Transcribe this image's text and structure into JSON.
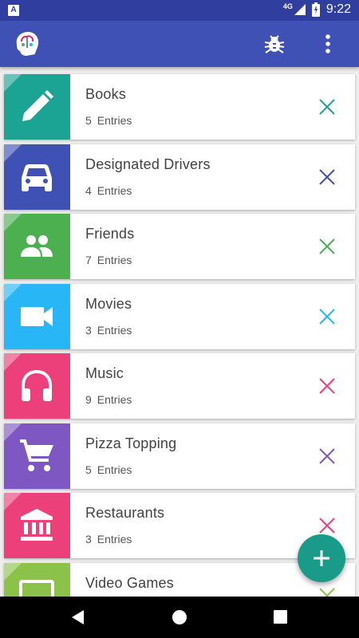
{
  "status_bar": {
    "network": "4G",
    "time": "9:22",
    "app_icon_letter": "A"
  },
  "app_bar": {
    "actions": [
      "bug-icon",
      "more-vert-icon"
    ]
  },
  "entries_label": "Entries",
  "categories": [
    {
      "title": "Books",
      "count": "5",
      "icon": "pencil-icon",
      "color": "#1ba394"
    },
    {
      "title": "Designated Drivers",
      "count": "4",
      "icon": "car-icon",
      "color": "#3f51b5"
    },
    {
      "title": "Friends",
      "count": "7",
      "icon": "people-icon",
      "color": "#4caf50"
    },
    {
      "title": "Movies",
      "count": "3",
      "icon": "videocam-icon",
      "color": "#29b6f6"
    },
    {
      "title": "Music",
      "count": "9",
      "icon": "headphones-icon",
      "color": "#ec407a"
    },
    {
      "title": "Pizza Topping",
      "count": "5",
      "icon": "cart-icon",
      "color": "#7e57c2"
    },
    {
      "title": "Restaurants",
      "count": "3",
      "icon": "bank-icon",
      "color": "#ec407a"
    },
    {
      "title": "Video Games",
      "count": "",
      "icon": "monitor-icon",
      "color": "#8bc34a"
    }
  ],
  "fab": {
    "icon": "plus-icon",
    "color": "#1a9b8a"
  },
  "nav": [
    "back-icon",
    "home-icon",
    "recents-icon"
  ]
}
